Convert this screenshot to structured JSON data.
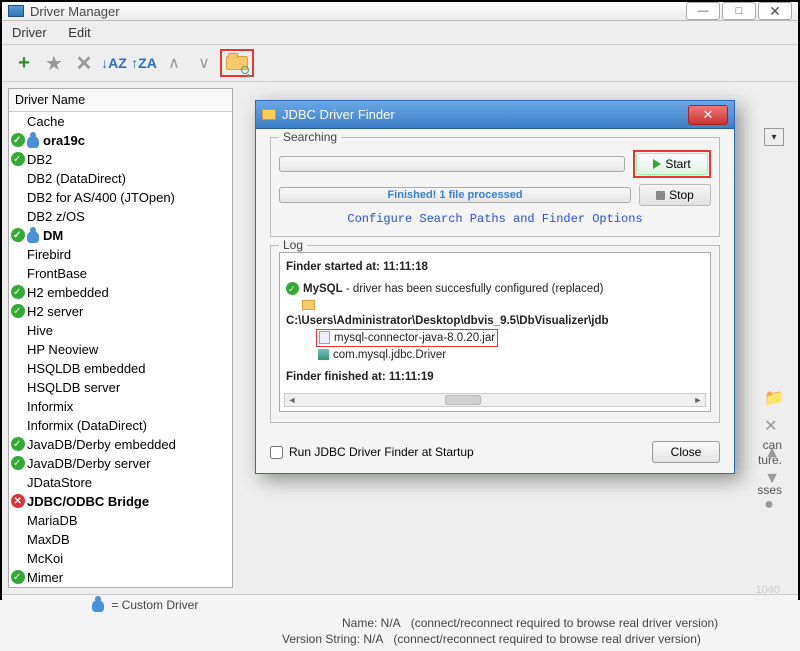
{
  "window": {
    "title": "Driver Manager"
  },
  "menu": {
    "driver": "Driver",
    "edit": "Edit"
  },
  "toolbar": {
    "sort_az": "↓AZ",
    "sort_za": "↑ZA"
  },
  "panel": {
    "header": "Driver Name",
    "items": [
      {
        "label": "Cache",
        "mark": null,
        "bold": false
      },
      {
        "label": "ora19c",
        "mark": "check",
        "bold": true,
        "user": true
      },
      {
        "label": "DB2",
        "mark": "check",
        "bold": false
      },
      {
        "label": "DB2 (DataDirect)",
        "mark": null,
        "bold": false
      },
      {
        "label": "DB2 for AS/400 (JTOpen)",
        "mark": null,
        "bold": false
      },
      {
        "label": "DB2 z/OS",
        "mark": null,
        "bold": false
      },
      {
        "label": "DM",
        "mark": "check",
        "bold": true,
        "user": true
      },
      {
        "label": "Firebird",
        "mark": null,
        "bold": false
      },
      {
        "label": "FrontBase",
        "mark": null,
        "bold": false
      },
      {
        "label": "H2 embedded",
        "mark": "check",
        "bold": false
      },
      {
        "label": "H2 server",
        "mark": "check",
        "bold": false
      },
      {
        "label": "Hive",
        "mark": null,
        "bold": false
      },
      {
        "label": "HP Neoview",
        "mark": null,
        "bold": false
      },
      {
        "label": "HSQLDB embedded",
        "mark": null,
        "bold": false
      },
      {
        "label": "HSQLDB server",
        "mark": null,
        "bold": false
      },
      {
        "label": "Informix",
        "mark": null,
        "bold": false
      },
      {
        "label": "Informix (DataDirect)",
        "mark": null,
        "bold": false
      },
      {
        "label": "JavaDB/Derby embedded",
        "mark": "check",
        "bold": false
      },
      {
        "label": "JavaDB/Derby server",
        "mark": "check",
        "bold": false
      },
      {
        "label": "JDataStore",
        "mark": null,
        "bold": false
      },
      {
        "label": "JDBC/ODBC Bridge",
        "mark": "cross",
        "bold": true
      },
      {
        "label": "MariaDB",
        "mark": null,
        "bold": false
      },
      {
        "label": "MaxDB",
        "mark": null,
        "bold": false
      },
      {
        "label": "McKoi",
        "mark": null,
        "bold": false
      },
      {
        "label": "Mimer",
        "mark": "check",
        "bold": false
      }
    ]
  },
  "right": {
    "info1": "can",
    "info2": "ture.",
    "info3": "sses"
  },
  "footer": {
    "legend": " = Custom Driver",
    "name_label": "Name: N/A",
    "name_hint": "(connect/reconnect required to browse real driver version)",
    "ver_label": "Version String: N/A",
    "ver_hint": "(connect/reconnect required to browse real driver version)"
  },
  "dialog": {
    "title": "JDBC Driver Finder",
    "searching_legend": "Searching",
    "start": "Start",
    "stop": "Stop",
    "progress": "Finished! 1 file processed",
    "config_link": "Configure Search Paths and Finder Options",
    "log_legend": "Log",
    "log": {
      "started": "Finder started at: 11:11:18",
      "mysql_label": "MySQL",
      "mysql_rest": " - driver has been succesfully configured (replaced)",
      "path": "C:\\Users\\Administrator\\Desktop\\dbvis_9.5\\DbVisualizer\\jdb",
      "jar": "mysql-connector-java-8.0.20.jar",
      "cls": "com.mysql.jdbc.Driver",
      "finished": "Finder finished at: 11:11:19"
    },
    "startup_chk": "Run JDBC Driver Finder at Startup",
    "close": "Close"
  },
  "watermark": "1040"
}
